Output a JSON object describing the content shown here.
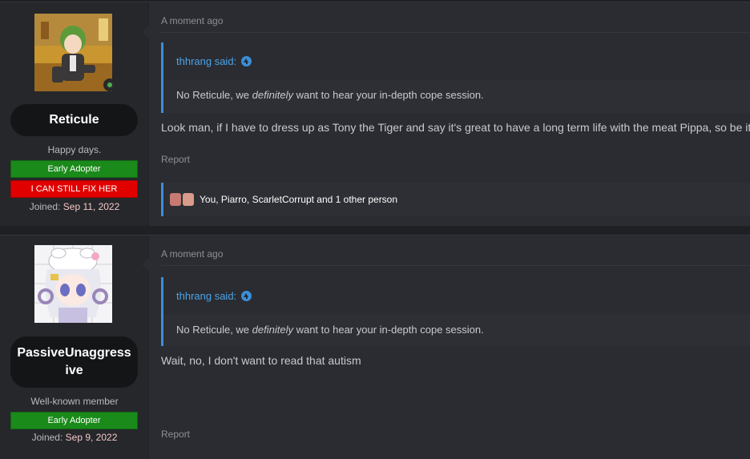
{
  "posts": [
    {
      "username": "Reticule",
      "user_title": "Happy days.",
      "banners": [
        "Early Adopter",
        "I CAN STILL FIX HER"
      ],
      "joined_label": "Joined:",
      "joined_date": "Sep 11, 2022",
      "timestamp": "A moment ago",
      "quote_author": "thhrang said:",
      "quote_pre": "No Reticule, we ",
      "quote_em": "definitely",
      "quote_post": " want to hear your in-depth cope session.",
      "message": "Look man, if I have to dress up as Tony the Tiger and say it's great to have a long term life with the meat Pippa, so be it.",
      "report_label": "Report",
      "reactions_text": "You, Piarro, ScarletCorrupt and 1 other person"
    },
    {
      "username": "PassiveUnaggressive",
      "user_title": "Well-known member",
      "banners": [
        "Early Adopter"
      ],
      "joined_label": "Joined:",
      "joined_date": "Sep 9, 2022",
      "timestamp": "A moment ago",
      "quote_author": "thhrang said:",
      "quote_pre": "No Reticule, we ",
      "quote_em": "definitely",
      "quote_post": " want to hear your in-depth cope session.",
      "message": "Wait, no, I don't want to read that autism",
      "report_label": "Report"
    }
  ],
  "colors": {
    "accent": "#3b8ed8",
    "banner_green": "#1a8a1a",
    "banner_red": "#e00000",
    "online": "#4caf50"
  },
  "icons": {
    "online_status": "online-user-icon",
    "quote_jump": "arrow-up-circle-icon",
    "reaction": "reaction-avatars-icon"
  }
}
